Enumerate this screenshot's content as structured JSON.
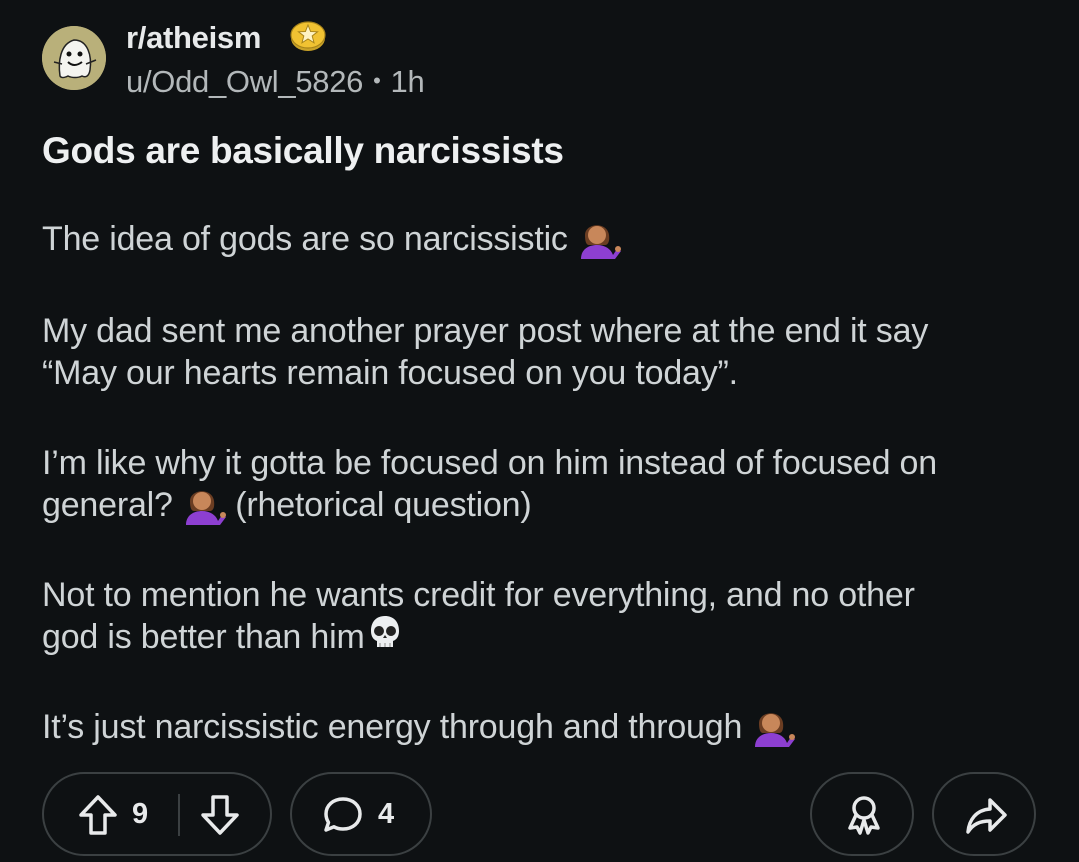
{
  "post": {
    "subreddit": "r/atheism",
    "author": "u/Odd_Owl_5826",
    "separator": "•",
    "age": "1h",
    "title": "Gods are basically narcissists",
    "body": {
      "p1": "The idea of gods are so narcissistic",
      "p2_line1": "My dad sent me another prayer post where at the end it say",
      "p2_line2": "“May our hearts remain focused on you today”.",
      "p3_line1": "I’m like why it gotta be focused on him instead of focused on",
      "p3_line2a": "general?",
      "p3_line2b": "(rhetorical question)",
      "p4_line1": "Not to mention he wants credit for everything, and no other",
      "p4_line2": "god is better than him",
      "p5": "It’s just narcissistic energy through and through"
    },
    "emojis": {
      "shrug": "person-tipping-hand-emoji",
      "skull": "skull-emoji"
    }
  },
  "actions": {
    "upvote_count": "9",
    "comment_count": "4",
    "icons": {
      "upvote": "arrow-up-icon",
      "downvote": "arrow-down-icon",
      "comment": "comment-bubble-icon",
      "award": "award-icon",
      "share": "share-arrow-icon"
    }
  },
  "colors": {
    "background": "#0e1113",
    "text": "#d7dadc",
    "border": "#3b4042",
    "award_gold": "#f1c232"
  }
}
